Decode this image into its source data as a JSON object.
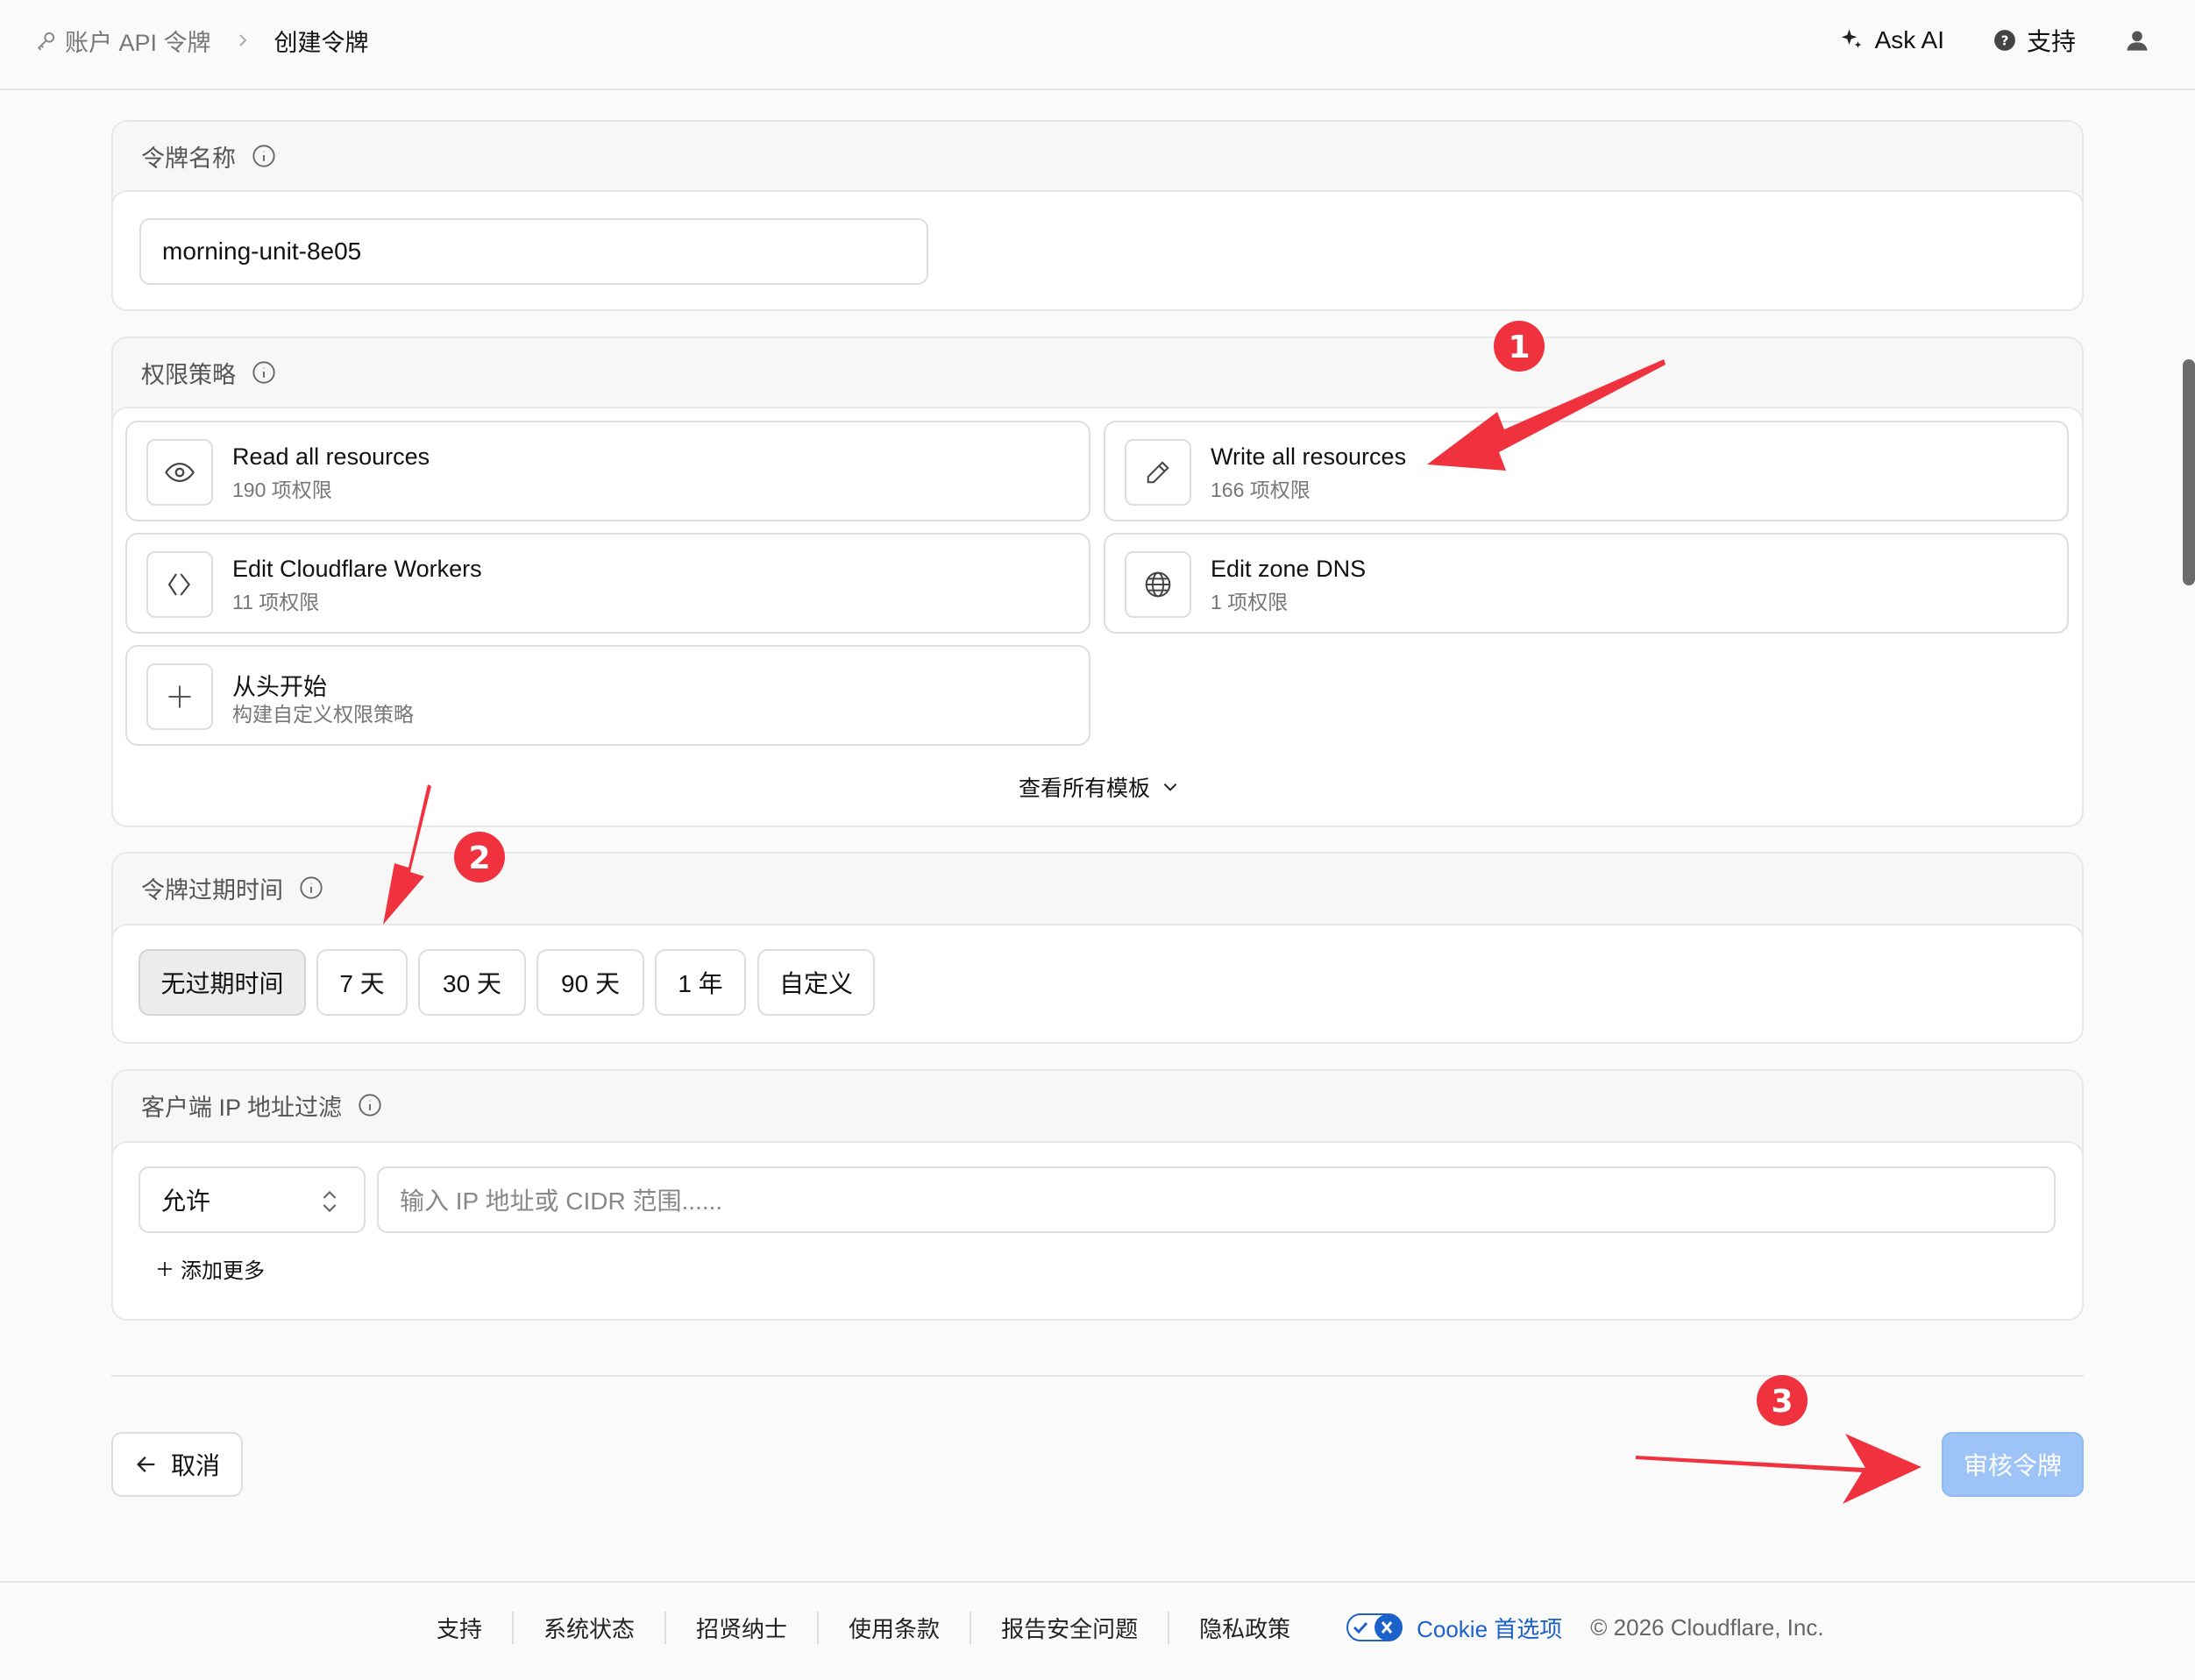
{
  "breadcrumb": {
    "parent": "账户 API 令牌",
    "current": "创建令牌"
  },
  "header": {
    "ask_ai": "Ask AI",
    "support": "支持"
  },
  "token_name": {
    "title": "令牌名称",
    "value": "morning-unit-8e05"
  },
  "permissions": {
    "title": "权限策略",
    "templates": [
      {
        "name": "Read all resources",
        "count": "190 项权限",
        "icon": "eye-icon"
      },
      {
        "name": "Write all resources",
        "count": "166 项权限",
        "icon": "pencil-icon"
      },
      {
        "name": "Edit Cloudflare Workers",
        "count": "11 项权限",
        "icon": "workers-icon"
      },
      {
        "name": "Edit zone DNS",
        "count": "1 项权限",
        "icon": "globe-icon"
      },
      {
        "name": "从头开始",
        "count": "构建自定义权限策略",
        "icon": "plus-icon"
      }
    ],
    "view_all": "查看所有模板"
  },
  "expiration": {
    "title": "令牌过期时间",
    "options": [
      "无过期时间",
      "7 天",
      "30 天",
      "90 天",
      "1 年",
      "自定义"
    ],
    "selected": "无过期时间"
  },
  "ip_filter": {
    "title": "客户端 IP 地址过滤",
    "mode": "允许",
    "placeholder": "输入 IP 地址或 CIDR 范围......",
    "add_more": "添加更多"
  },
  "actions": {
    "cancel": "取消",
    "review": "审核令牌"
  },
  "footer": {
    "links": [
      "支持",
      "系统状态",
      "招贤纳士",
      "使用条款",
      "报告安全问题",
      "隐私政策"
    ],
    "cookie": "Cookie 首选项",
    "copyright": "© 2026 Cloudflare, Inc."
  },
  "annotations": {
    "badges": [
      "1",
      "2",
      "3"
    ],
    "color": "#f0323f"
  },
  "colors": {
    "primary_disabled": "#9dc3f7",
    "link": "#1b61c9"
  }
}
